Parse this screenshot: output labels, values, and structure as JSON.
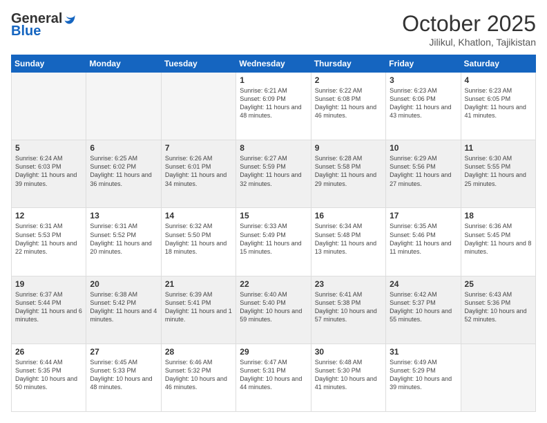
{
  "header": {
    "logo_line1": "General",
    "logo_line2": "Blue",
    "month_title": "October 2025",
    "location": "Jilikul, Khatlon, Tajikistan"
  },
  "weekdays": [
    "Sunday",
    "Monday",
    "Tuesday",
    "Wednesday",
    "Thursday",
    "Friday",
    "Saturday"
  ],
  "weeks": [
    [
      {
        "day": "",
        "empty": true
      },
      {
        "day": "",
        "empty": true
      },
      {
        "day": "",
        "empty": true
      },
      {
        "day": "1",
        "sunrise": "6:21 AM",
        "sunset": "6:09 PM",
        "daylight": "11 hours and 48 minutes."
      },
      {
        "day": "2",
        "sunrise": "6:22 AM",
        "sunset": "6:08 PM",
        "daylight": "11 hours and 46 minutes."
      },
      {
        "day": "3",
        "sunrise": "6:23 AM",
        "sunset": "6:06 PM",
        "daylight": "11 hours and 43 minutes."
      },
      {
        "day": "4",
        "sunrise": "6:23 AM",
        "sunset": "6:05 PM",
        "daylight": "11 hours and 41 minutes."
      }
    ],
    [
      {
        "day": "5",
        "sunrise": "6:24 AM",
        "sunset": "6:03 PM",
        "daylight": "11 hours and 39 minutes."
      },
      {
        "day": "6",
        "sunrise": "6:25 AM",
        "sunset": "6:02 PM",
        "daylight": "11 hours and 36 minutes."
      },
      {
        "day": "7",
        "sunrise": "6:26 AM",
        "sunset": "6:01 PM",
        "daylight": "11 hours and 34 minutes."
      },
      {
        "day": "8",
        "sunrise": "6:27 AM",
        "sunset": "5:59 PM",
        "daylight": "11 hours and 32 minutes."
      },
      {
        "day": "9",
        "sunrise": "6:28 AM",
        "sunset": "5:58 PM",
        "daylight": "11 hours and 29 minutes."
      },
      {
        "day": "10",
        "sunrise": "6:29 AM",
        "sunset": "5:56 PM",
        "daylight": "11 hours and 27 minutes."
      },
      {
        "day": "11",
        "sunrise": "6:30 AM",
        "sunset": "5:55 PM",
        "daylight": "11 hours and 25 minutes."
      }
    ],
    [
      {
        "day": "12",
        "sunrise": "6:31 AM",
        "sunset": "5:53 PM",
        "daylight": "11 hours and 22 minutes."
      },
      {
        "day": "13",
        "sunrise": "6:31 AM",
        "sunset": "5:52 PM",
        "daylight": "11 hours and 20 minutes."
      },
      {
        "day": "14",
        "sunrise": "6:32 AM",
        "sunset": "5:50 PM",
        "daylight": "11 hours and 18 minutes."
      },
      {
        "day": "15",
        "sunrise": "6:33 AM",
        "sunset": "5:49 PM",
        "daylight": "11 hours and 15 minutes."
      },
      {
        "day": "16",
        "sunrise": "6:34 AM",
        "sunset": "5:48 PM",
        "daylight": "11 hours and 13 minutes."
      },
      {
        "day": "17",
        "sunrise": "6:35 AM",
        "sunset": "5:46 PM",
        "daylight": "11 hours and 11 minutes."
      },
      {
        "day": "18",
        "sunrise": "6:36 AM",
        "sunset": "5:45 PM",
        "daylight": "11 hours and 8 minutes."
      }
    ],
    [
      {
        "day": "19",
        "sunrise": "6:37 AM",
        "sunset": "5:44 PM",
        "daylight": "11 hours and 6 minutes."
      },
      {
        "day": "20",
        "sunrise": "6:38 AM",
        "sunset": "5:42 PM",
        "daylight": "11 hours and 4 minutes."
      },
      {
        "day": "21",
        "sunrise": "6:39 AM",
        "sunset": "5:41 PM",
        "daylight": "11 hours and 1 minute."
      },
      {
        "day": "22",
        "sunrise": "6:40 AM",
        "sunset": "5:40 PM",
        "daylight": "10 hours and 59 minutes."
      },
      {
        "day": "23",
        "sunrise": "6:41 AM",
        "sunset": "5:38 PM",
        "daylight": "10 hours and 57 minutes."
      },
      {
        "day": "24",
        "sunrise": "6:42 AM",
        "sunset": "5:37 PM",
        "daylight": "10 hours and 55 minutes."
      },
      {
        "day": "25",
        "sunrise": "6:43 AM",
        "sunset": "5:36 PM",
        "daylight": "10 hours and 52 minutes."
      }
    ],
    [
      {
        "day": "26",
        "sunrise": "6:44 AM",
        "sunset": "5:35 PM",
        "daylight": "10 hours and 50 minutes."
      },
      {
        "day": "27",
        "sunrise": "6:45 AM",
        "sunset": "5:33 PM",
        "daylight": "10 hours and 48 minutes."
      },
      {
        "day": "28",
        "sunrise": "6:46 AM",
        "sunset": "5:32 PM",
        "daylight": "10 hours and 46 minutes."
      },
      {
        "day": "29",
        "sunrise": "6:47 AM",
        "sunset": "5:31 PM",
        "daylight": "10 hours and 44 minutes."
      },
      {
        "day": "30",
        "sunrise": "6:48 AM",
        "sunset": "5:30 PM",
        "daylight": "10 hours and 41 minutes."
      },
      {
        "day": "31",
        "sunrise": "6:49 AM",
        "sunset": "5:29 PM",
        "daylight": "10 hours and 39 minutes."
      },
      {
        "day": "",
        "empty": true
      }
    ]
  ]
}
